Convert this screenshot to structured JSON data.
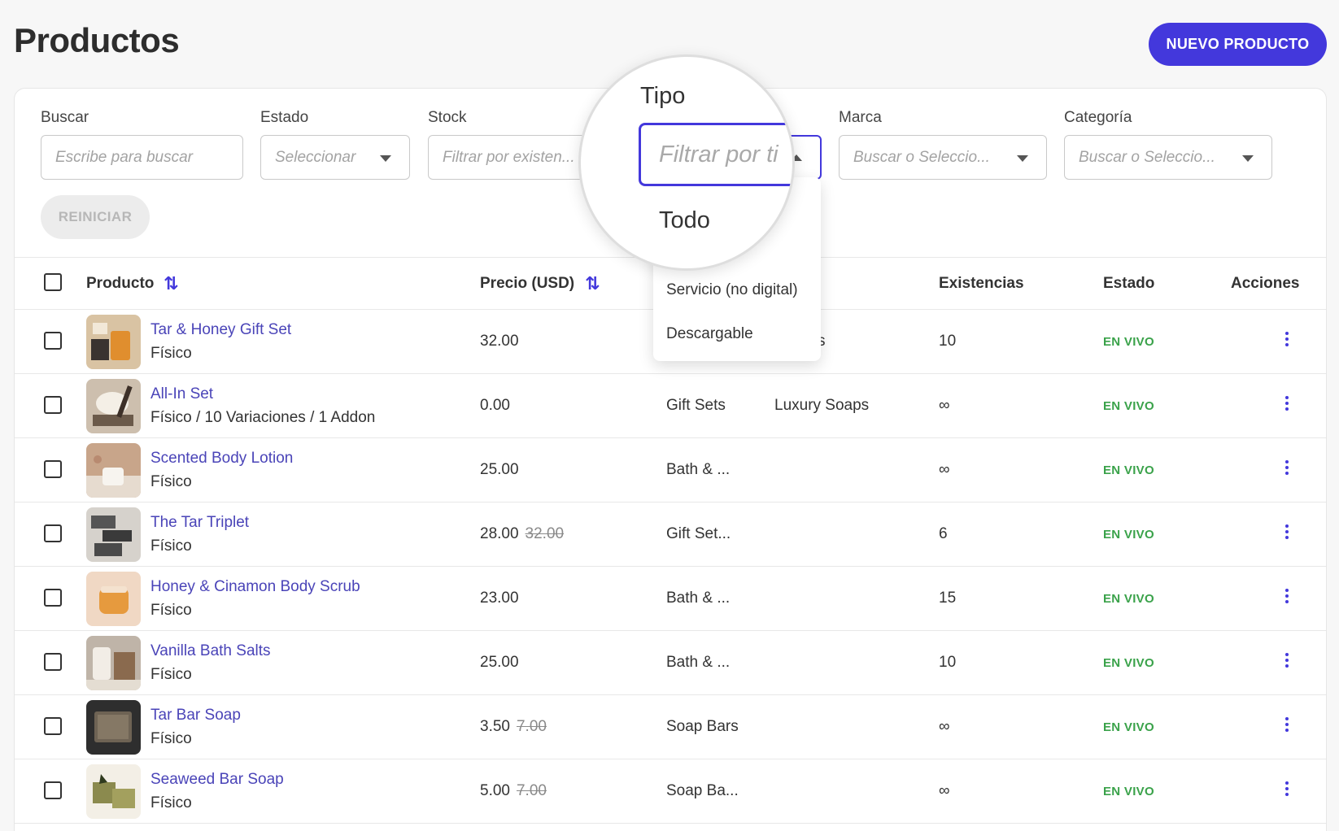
{
  "header": {
    "title": "Productos",
    "new_button": "NUEVO PRODUCTO"
  },
  "filters": {
    "search": {
      "label": "Buscar",
      "placeholder": "Escribe para buscar"
    },
    "estado": {
      "label": "Estado",
      "placeholder": "Seleccionar"
    },
    "stock": {
      "label": "Stock",
      "placeholder": "Filtrar por existen..."
    },
    "tipo": {
      "label": "Tipo",
      "placeholder": "Filtrar por ti"
    },
    "marca": {
      "label": "Marca",
      "placeholder": "Buscar o Seleccio..."
    },
    "categoria": {
      "label": "Categoría",
      "placeholder": "Buscar o Seleccio..."
    },
    "reset": "REINICIAR"
  },
  "tipo_dropdown": {
    "options": [
      "Todo",
      "Servicio (no digital)",
      "Descargable"
    ]
  },
  "table": {
    "headers": {
      "producto": "Producto",
      "precio": "Precio (USD)",
      "existencias": "Existencias",
      "estado": "Estado",
      "acciones": "Acciones"
    },
    "rows": [
      {
        "name": "Tar & Honey Gift Set",
        "type": "Físico",
        "price": "32.00",
        "old_price": "",
        "category": "",
        "brand": "s",
        "stock": "10",
        "status": "EN VIVO"
      },
      {
        "name": "All-In Set",
        "type": "Físico / 10 Variaciones / 1 Addon",
        "price": "0.00",
        "old_price": "",
        "category": "Gift Sets",
        "brand": "Luxury Soaps",
        "stock": "∞",
        "status": "EN VIVO"
      },
      {
        "name": "Scented Body Lotion",
        "type": "Físico",
        "price": "25.00",
        "old_price": "",
        "category": "Bath & ...",
        "brand": "",
        "stock": "∞",
        "status": "EN VIVO"
      },
      {
        "name": "The Tar Triplet",
        "type": "Físico",
        "price": "28.00",
        "old_price": "32.00",
        "category": "Gift Set...",
        "brand": "",
        "stock": "6",
        "status": "EN VIVO"
      },
      {
        "name": "Honey & Cinamon Body Scrub",
        "type": "Físico",
        "price": "23.00",
        "old_price": "",
        "category": "Bath & ...",
        "brand": "",
        "stock": "15",
        "status": "EN VIVO"
      },
      {
        "name": "Vanilla Bath Salts",
        "type": "Físico",
        "price": "25.00",
        "old_price": "",
        "category": "Bath & ...",
        "brand": "",
        "stock": "10",
        "status": "EN VIVO"
      },
      {
        "name": "Tar Bar Soap",
        "type": "Físico",
        "price": "3.50",
        "old_price": "7.00",
        "category": "Soap Bars",
        "brand": "",
        "stock": "∞",
        "status": "EN VIVO"
      },
      {
        "name": "Seaweed Bar Soap",
        "type": "Físico",
        "price": "5.00",
        "old_price": "7.00",
        "category": "Soap Ba...",
        "brand": "",
        "stock": "∞",
        "status": "EN VIVO"
      }
    ]
  },
  "colors": {
    "accent": "#4338dc",
    "status_live": "#3aa24a",
    "link": "#4a44b8"
  }
}
